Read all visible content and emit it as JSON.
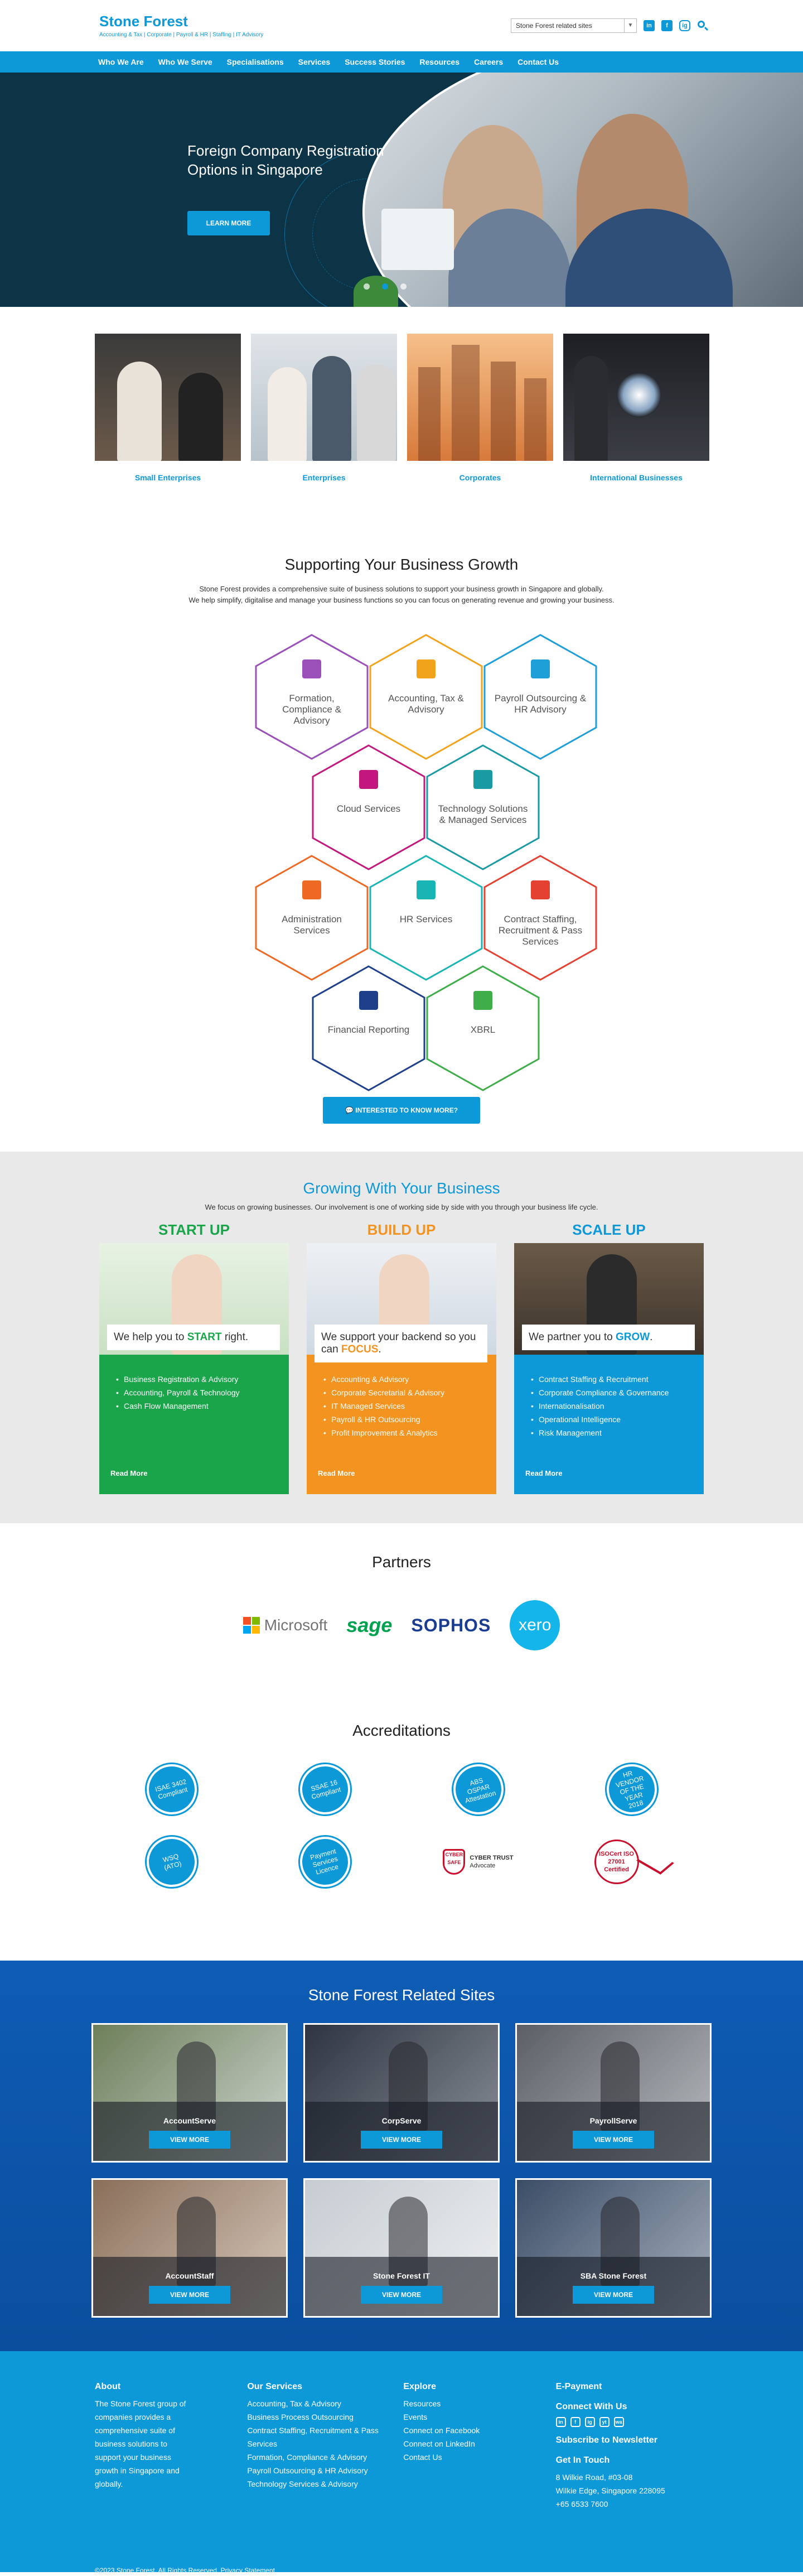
{
  "header": {
    "logo_title": "Stone Forest",
    "logo_sub": "Accounting & Tax | Corporate | Payroll & HR | Staffing | IT Advisory",
    "site_select": "Stone Forest related sites",
    "social": [
      "in",
      "f",
      "ig"
    ]
  },
  "nav": [
    "Who We Are",
    "Who We Serve",
    "Specialisations",
    "Services",
    "Success Stories",
    "Resources",
    "Careers",
    "Contact Us"
  ],
  "hero": {
    "title": "Foreign Company Registration Options in Singapore",
    "button": "LEARN MORE"
  },
  "segments": [
    "Small Enterprises",
    "Enterprises",
    "Corporates",
    "International Businesses"
  ],
  "growth": {
    "title": "Supporting Your Business Growth",
    "line1": "Stone Forest provides a comprehensive suite of business solutions to support your business growth in Singapore and globally.",
    "line2": "We help simplify, digitalise and manage your business functions so you can focus on generating revenue and growing your business.",
    "services": [
      {
        "label": "Formation, Compliance & Advisory",
        "color": "#9b4fb8"
      },
      {
        "label": "Accounting, Tax & Advisory",
        "color": "#f2a31c"
      },
      {
        "label": "Payroll Outsourcing & HR Advisory",
        "color": "#1e9fd8"
      },
      {
        "label": "Cloud Services",
        "color": "#c2187e"
      },
      {
        "label": "Technology Solutions & Managed Services",
        "color": "#1a9aa3"
      },
      {
        "label": "Administration Services",
        "color": "#ee6a24"
      },
      {
        "label": "HR Services",
        "color": "#19b4b4"
      },
      {
        "label": "Contract Staffing, Recruitment & Pass Services",
        "color": "#e54133"
      },
      {
        "label": "Financial Reporting",
        "color": "#1e3f8a"
      },
      {
        "label": "XBRL",
        "color": "#3fae49"
      }
    ],
    "cta": "INTERESTED TO KNOW MORE?"
  },
  "growing": {
    "title": "Growing With Your Business",
    "sub": "We focus on growing businesses. Our involvement is one of working side by side with you through your business life cycle.",
    "columns": [
      {
        "heading": "START UP",
        "caption_pre": "We help you to ",
        "caption_em": "START",
        "caption_post": " right.",
        "items": [
          "Business Registration & Advisory",
          "Accounting, Payroll & Technology",
          "Cash Flow Management"
        ],
        "read": "Read More",
        "color": "#1aa54a"
      },
      {
        "heading": "BUILD UP",
        "caption_pre": "We support your backend so you can ",
        "caption_em": "FOCUS",
        "caption_post": ".",
        "items": [
          "Accounting & Advisory",
          "Corporate Secretarial & Advisory",
          "IT Managed Services",
          "Payroll & HR Outsourcing",
          "Profit Improvement & Analytics"
        ],
        "read": "Read More",
        "color": "#f39320"
      },
      {
        "heading": "SCALE UP",
        "caption_pre": "We partner you to ",
        "caption_em": "GROW",
        "caption_post": ".",
        "items": [
          "Contract Staffing & Recruitment",
          "Corporate Compliance & Governance",
          "Internationalisation",
          "Operational Intelligence",
          "Risk Management"
        ],
        "read": "Read More",
        "color": "#0d98d8"
      }
    ]
  },
  "partners": {
    "title": "Partners",
    "logos": [
      "Microsoft",
      "sage",
      "SOPHOS",
      "xero"
    ]
  },
  "accreditations": {
    "title": "Accreditations",
    "badges": [
      "ISAE 3402 Compliant",
      "SSAE 16 Compliant",
      "ABS OSPAR Attestation",
      "HR VENDOR OF THE YEAR 2018",
      "WSQ (ATO)",
      "Payment Services Licence"
    ],
    "cyber": {
      "mark": "CYBER SAFE",
      "title": "CYBER TRUST",
      "sub": "Advocate"
    },
    "iso": "ISOCert ISO 27001 Certified"
  },
  "related": {
    "title": "Stone Forest Related Sites",
    "view": "VIEW MORE",
    "sites": [
      "AccountServe",
      "CorpServe",
      "PayrollServe",
      "AccountStaff",
      "Stone Forest IT",
      "SBA Stone Forest"
    ]
  },
  "footer": {
    "about_title": "About",
    "about_text": "The Stone Forest group of companies provides a comprehensive suite of business solutions to support your business growth in Singapore and globally.",
    "services_title": "Our Services",
    "services": [
      "Accounting, Tax & Advisory",
      "Business Process Outsourcing",
      "Contract Staffing, Recruitment & Pass Services",
      "Formation, Compliance & Advisory",
      "Payroll Outsourcing & HR Advisory",
      "Technology Services & Advisory"
    ],
    "explore_title": "Explore",
    "explore": [
      "Resources",
      "Events",
      "Connect on Facebook",
      "Connect on LinkedIn",
      "Contact Us"
    ],
    "epayment": "E-Payment",
    "connect": "Connect With Us",
    "social": [
      "in",
      "f",
      "ig",
      "yt",
      "wa"
    ],
    "newsletter": "Subscribe to Newsletter",
    "touch": "Get In Touch",
    "address1": "8 Wilkie Road, #03-08",
    "address2": "Wilkie Edge, Singapore 228095",
    "phone": "+65 6533 7600",
    "copyright": "©2023 Stone Forest. All Rights Reserved. Privacy Statement"
  }
}
